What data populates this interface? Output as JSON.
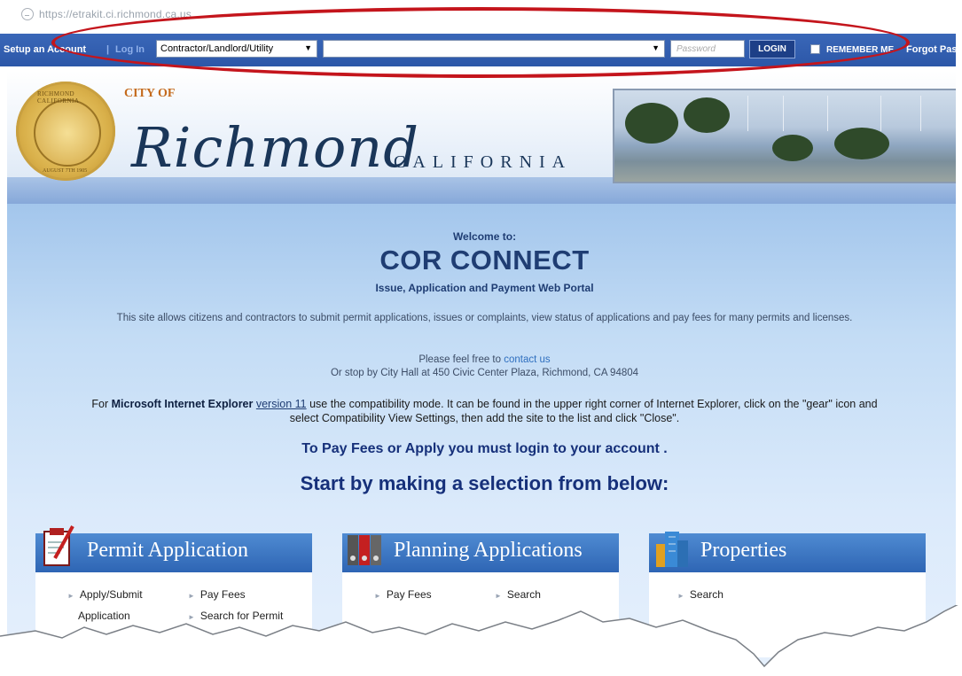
{
  "browser": {
    "url": "https://etrakit.ci.richmond.ca.us"
  },
  "login_bar": {
    "setup_account": "Setup an Account",
    "separator": "|",
    "log_in": "Log In",
    "user_type": "Contractor/Landlord/Utility",
    "username_value": "",
    "password_placeholder": "Password",
    "login_button": "LOGIN",
    "remember_me": "REMEMBER ME",
    "forgot_password": "Forgot Pas"
  },
  "banner": {
    "city_of": "CITY OF",
    "city_name": "Richmond",
    "state": "CALIFORNIA",
    "seal_top": "RICHMOND CALIFORNIA",
    "seal_bottom": "AUGUST 7TH 1905"
  },
  "welcome": {
    "welcome_to": "Welcome to:",
    "title": "COR CONNECT",
    "subtitle": "Issue, Application and Payment Web Portal",
    "description": "This site allows citizens and contractors to submit permit applications, issues or complaints, view status of applications and pay fees for many permits and licenses.",
    "contact_prefix": "Please feel free to",
    "contact_link": "contact us",
    "stop_by": "Or stop by City Hall at 450 Civic Center Plaza, Richmond, CA 94804",
    "ie_prefix": "For",
    "ie_name": "Microsoft Internet Explorer",
    "ie_version": "version 11",
    "ie_text": "use the compatibility mode. It can be found in the upper right corner of Internet Explorer, click on the \"gear\" icon and select Compatibility View Settings, then add the site to the list and click \"Close\".",
    "pay_fees_notice": "To Pay Fees or Apply you must login to your account .",
    "start_by": "Start by making a selection from below:"
  },
  "panels": {
    "permit": {
      "title": "Permit Application",
      "items": [
        "Apply/Submit",
        "Application",
        "Pay Fees",
        "Search for Permit"
      ]
    },
    "planning": {
      "title": "Planning Applications",
      "items": [
        "Pay Fees",
        "Search"
      ]
    },
    "properties": {
      "title": "Properties",
      "items": [
        "Search"
      ]
    }
  },
  "colors": {
    "login_bar": "#2c57a8",
    "highlight_oval": "#c4151c",
    "heading_blue": "#1f3d73",
    "panel_header": "#2e65b4"
  }
}
